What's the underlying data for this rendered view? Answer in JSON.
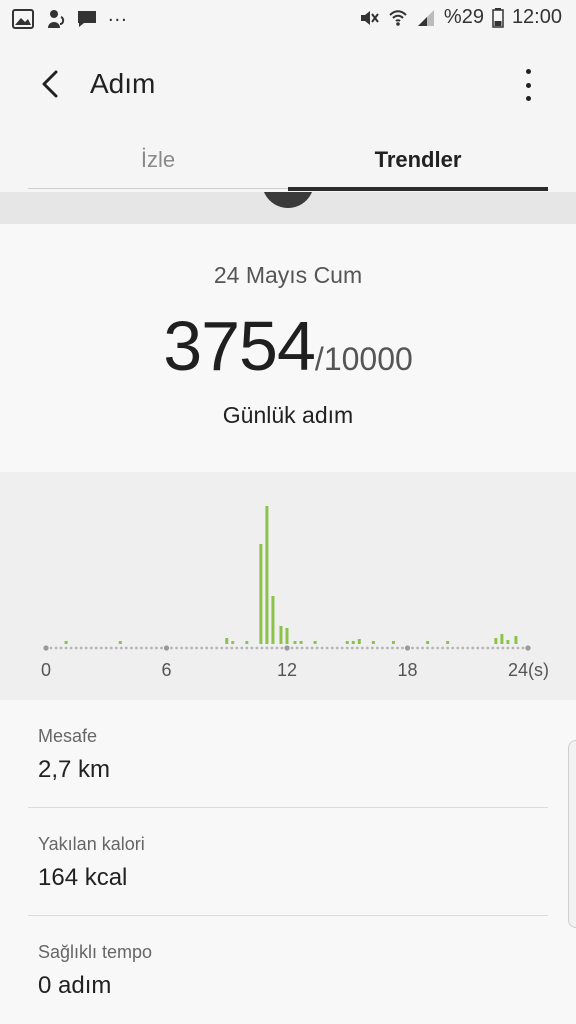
{
  "status_bar": {
    "left_icons": [
      "image-icon",
      "cat-icon",
      "message-icon"
    ],
    "more": "...",
    "right_icons": [
      "mute-icon",
      "wifi-icon",
      "signal-icon"
    ],
    "battery": "%29",
    "time": "12:00"
  },
  "app_bar": {
    "title": "Adım",
    "back_icon": "chevron-left-icon",
    "menu_icon": "more-vert-icon"
  },
  "tabs": [
    {
      "label": "İzle",
      "active": false
    },
    {
      "label": "Trendler",
      "active": true
    }
  ],
  "summary": {
    "date": "24 Mayıs Cum",
    "steps": "3754",
    "goal": "/10000",
    "caption": "Günlük adım"
  },
  "colors": {
    "accent_bar": "#8bc34a",
    "axis_dots": "#b5b5b5",
    "indicator": "#2b2b2b"
  },
  "chart_data": {
    "type": "bar",
    "xlabel": "",
    "ylabel": "",
    "x_ticks": [
      "0",
      "6",
      "12",
      "18",
      "24(s)"
    ],
    "xlim": [
      0,
      24
    ],
    "series": [
      {
        "values": [
          {
            "x": 1.0,
            "y": 3
          },
          {
            "x": 3.7,
            "y": 3
          },
          {
            "x": 9.0,
            "y": 6
          },
          {
            "x": 9.3,
            "y": 3
          },
          {
            "x": 10.0,
            "y": 3
          },
          {
            "x": 10.7,
            "y": 100
          },
          {
            "x": 11.0,
            "y": 138
          },
          {
            "x": 11.3,
            "y": 48
          },
          {
            "x": 11.7,
            "y": 18
          },
          {
            "x": 12.0,
            "y": 16
          },
          {
            "x": 12.4,
            "y": 3
          },
          {
            "x": 12.7,
            "y": 3
          },
          {
            "x": 13.4,
            "y": 3
          },
          {
            "x": 15.0,
            "y": 3
          },
          {
            "x": 15.3,
            "y": 3
          },
          {
            "x": 15.6,
            "y": 5
          },
          {
            "x": 16.3,
            "y": 3
          },
          {
            "x": 17.3,
            "y": 3
          },
          {
            "x": 19.0,
            "y": 3
          },
          {
            "x": 20.0,
            "y": 3
          },
          {
            "x": 22.4,
            "y": 6
          },
          {
            "x": 22.7,
            "y": 10
          },
          {
            "x": 23.0,
            "y": 4
          },
          {
            "x": 23.4,
            "y": 8
          }
        ]
      }
    ]
  },
  "stats": [
    {
      "label": "Mesafe",
      "value": "2,7 km"
    },
    {
      "label": "Yakılan kalori",
      "value": "164 kcal"
    },
    {
      "label": "Sağlıklı tempo",
      "value": "0 adım"
    }
  ]
}
